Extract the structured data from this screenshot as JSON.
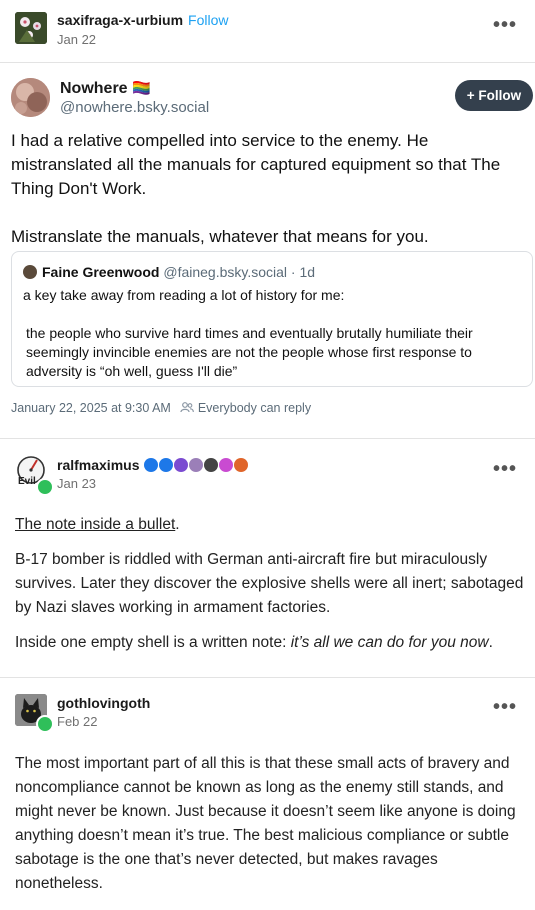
{
  "post1": {
    "username": "saxifraga-x-urbium",
    "follow_label": "Follow",
    "date": "Jan 22",
    "more_label": "•••"
  },
  "bsky": {
    "display_name": "Nowhere",
    "flag": "🏳️‍🌈",
    "handle": "@nowhere.bsky.social",
    "follow_button": "+ Follow",
    "paragraph1": "I had a relative compelled into service to the enemy. He mistranslated all the manuals for captured equipment so that The Thing Don't Work.",
    "paragraph2": "Mistranslate the manuals, whatever that means for you.",
    "quote": {
      "author": "Faine Greenwood",
      "handle_time": "@faineg.bsky.social · 1d",
      "line1": "a key take away from reading a lot of history for me:",
      "line2": "the people who survive hard times and eventually brutally humiliate their seemingly invincible enemies are not the people whose first response to adversity is “oh well, guess I'll die”"
    },
    "timestamp": "January 22, 2025 at 9:30 AM",
    "reply_setting": "Everybody can reply"
  },
  "post2": {
    "username": "ralfmaximus",
    "date": "Jan 23",
    "more_label": "•••",
    "title": "The note inside a bullet",
    "title_suffix": ".",
    "paragraph1": "B-17 bomber is riddled with German anti-aircraft fire but miraculously survives. Later they discover the explosive shells were all inert; sabotaged by Nazi slaves working in armament factories.",
    "paragraph2_prefix": "Inside one empty shell is a written note: ",
    "paragraph2_italic": "it’s all we can do for you now",
    "paragraph2_suffix": ".",
    "badge_colors": [
      "#1d78e8",
      "#1d78e8",
      "#7b4bd1",
      "#9b7fb8",
      "#444444",
      "#c94bd1",
      "#e0652a"
    ]
  },
  "post3": {
    "username": "gothlovingoth",
    "date": "Feb 22",
    "more_label": "•••",
    "paragraph1": "The most important part of all this is that these small acts of bravery and noncompliance cannot be known as long as the enemy still stands, and might never be known. Just because it doesn’t seem like anyone is doing anything doesn’t mean it’s true. The best malicious compliance or subtle sabotage is the one that’s never detected, but makes ravages nonetheless."
  }
}
